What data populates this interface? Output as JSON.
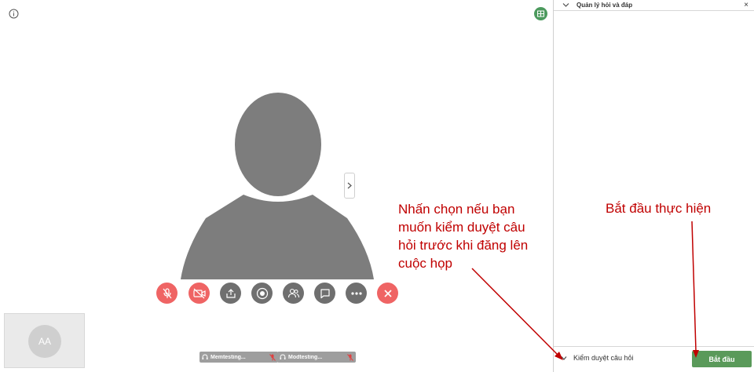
{
  "self_view": {
    "initials": "AA"
  },
  "participants": [
    {
      "name": "Memtesting..."
    },
    {
      "name": "Modtesting..."
    }
  ],
  "toolbar": {
    "buttons": [
      {
        "icon": "mic-muted-icon"
      },
      {
        "icon": "video-off-icon"
      },
      {
        "icon": "share-icon"
      },
      {
        "icon": "record-icon"
      },
      {
        "icon": "participants-icon"
      },
      {
        "icon": "chat-icon"
      },
      {
        "icon": "more-icon"
      },
      {
        "icon": "close-icon"
      }
    ]
  },
  "panel": {
    "title": "Quản lý hỏi và đáp",
    "close_label": "×",
    "moderate_label": "Kiểm duyệt câu hỏi",
    "start_button_label": "Bắt đầu"
  },
  "annotations": {
    "moderate_hint": [
      "Nhấn chọn nếu bạn",
      "muốn kiểm duyệt câu",
      "hỏi trước khi đăng lên",
      "cuộc họp"
    ],
    "start_hint": "Bắt đầu thực hiện"
  },
  "colors": {
    "accent_red": "#ef6464",
    "control_grey": "#6f6f6f",
    "start_green": "#5a9a5a",
    "annotation_red": "#c00000"
  }
}
